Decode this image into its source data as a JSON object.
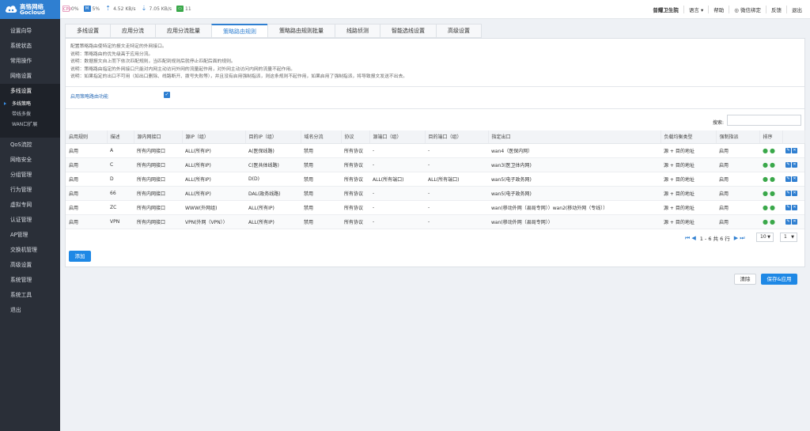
{
  "brand": {
    "name_cn": "高恪网络",
    "name_en": "Gocloud",
    "color": "#2f7fd1"
  },
  "stats": {
    "cpu": "0%",
    "memory": "5%",
    "upload": "4.52 KB/s",
    "download": "7.05 KB/s",
    "users": "11"
  },
  "topnav": {
    "hospital": "普耀卫生院",
    "language": "语言 ▾",
    "help": "帮助",
    "wechat": "微信绑定",
    "feedback": "反馈",
    "logout": "退出"
  },
  "sidebar": {
    "items": [
      "设置向导",
      "系统状态",
      "常用操作",
      "网络设置",
      "多线设置"
    ],
    "sub_items": [
      "多线策略",
      "带线多拨",
      "WAN口扩展"
    ],
    "items_after": [
      "QoS流控",
      "网络安全",
      "分组管理",
      "行为管理",
      "虚拟专网",
      "认证管理",
      "AP管理",
      "交换机管理",
      "高级设置",
      "系统管理",
      "系统工具",
      "退出"
    ]
  },
  "tabs": [
    "多线设置",
    "应用分流",
    "应用分流批量",
    "策略路由规则",
    "策略路由规则批量",
    "线路侦测",
    "智能选线设置",
    "高级设置"
  ],
  "description": [
    "配置策略路由使特定的报文走特定的外网接口。",
    "说明：策略路由的优先级高于应用分流。",
    "说明：数据报文自上而下依次匹配规则，当匹配到规则后就停止匹配后面的规则。",
    "说明：策略路由指定的外网接口只能对内网主动访问外网的流量起作用，对外网主动访问内网的流量不起作用。",
    "说明：如果指定的出口不可用（如出口删除、线路断开、拨号失败等），并且没有启用强制指派，则这条规则不起作用，如果启用了强制指派，将导致报文发送不出去。"
  ],
  "enable_label": "启用策略路由功能",
  "search_label": "搜索:",
  "table": {
    "headers": [
      "启用规则",
      "描述",
      "源内网接口",
      "源IP（组）",
      "目的IP（组）",
      "域名分流",
      "协议",
      "源端口（组）",
      "目的端口（组）",
      "指定出口",
      "负载均衡类型",
      "强制指派",
      "排序",
      ""
    ],
    "rows": [
      [
        "启用",
        "A",
        "所有内网接口",
        "ALL(所有IP)",
        "A(医保线路)",
        "禁用",
        "所有协议",
        "-",
        "-",
        "wan4（医保内网）",
        "源 + 目的地址",
        "启用"
      ],
      [
        "启用",
        "C",
        "所有内网接口",
        "ALL(所有IP)",
        "C(医共体线路)",
        "禁用",
        "所有协议",
        "-",
        "-",
        "wan3(医卫体内网)",
        "源 + 目的地址",
        "启用"
      ],
      [
        "启用",
        "D",
        "所有内网接口",
        "ALL(所有IP)",
        "D(D)",
        "禁用",
        "所有协议",
        "ALL(所有端口)",
        "ALL(所有端口)",
        "wan5(电子政务网)",
        "源 + 目的地址",
        "启用"
      ],
      [
        "启用",
        "66",
        "所有内网接口",
        "ALL(所有IP)",
        "DAL(政务线路)",
        "禁用",
        "所有协议",
        "-",
        "-",
        "wan5(电子政务网)",
        "源 + 目的地址",
        "启用"
      ],
      [
        "启用",
        "ZC",
        "所有内网接口",
        "WWW(外网组)",
        "ALL(所有IP)",
        "禁用",
        "所有协议",
        "-",
        "-",
        "wan(移动外网（县局专网））wan2(移动外网（专线））",
        "源 + 目的地址",
        "启用"
      ],
      [
        "启用",
        "VPN",
        "所有内网接口",
        "VPN(外网（VPN））",
        "ALL(所有IP)",
        "禁用",
        "所有协议",
        "-",
        "-",
        "wan(移动外网（县局专网））",
        "源 + 目的地址",
        "启用"
      ]
    ]
  },
  "pager": {
    "summary": "1 - 6 共 6 行",
    "page_size": "10",
    "page": "1"
  },
  "buttons": {
    "add": "添加",
    "clear": "清除",
    "save": "保存&应用"
  }
}
